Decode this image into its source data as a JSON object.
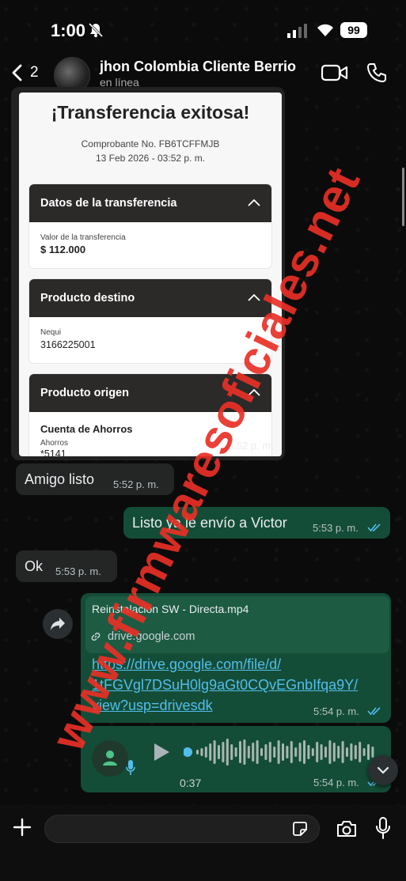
{
  "status_bar": {
    "time": "1:00",
    "battery": "99"
  },
  "header": {
    "unread_count": "2",
    "contact_name": "jhon Colombia Cliente Berrio",
    "contact_status": "en línea"
  },
  "receipt": {
    "title": "¡Transferencia exitosa!",
    "voucher": "Comprobante No. FB6TCFFMJB",
    "date": "13 Feb 2026 - 03:52 p. m.",
    "sections": [
      {
        "title": "Datos de la transferencia",
        "label": "Valor de la transferencia",
        "value": "$ 112.000"
      },
      {
        "title": "Producto destino",
        "label": "Nequi",
        "value": "3166225001"
      },
      {
        "title": "Producto origen",
        "value_bold": "Cuenta de Ahorros",
        "label": "Ahorros",
        "value": "*5141"
      }
    ],
    "time": "5:52 p. m."
  },
  "messages": [
    {
      "direction": "in",
      "text": "Amigo listo",
      "time": "5:52 p. m."
    },
    {
      "direction": "out",
      "text": "Listo ya le envío a Victor",
      "time": "5:53 p. m."
    },
    {
      "direction": "in",
      "text": "Ok",
      "time": "5:53 p. m."
    }
  ],
  "link_message": {
    "preview_title": "Reinstalacion SW - Directa.mp4",
    "preview_domain": "drive.google.com",
    "url_lines": [
      "https://drive.google.com/file/d/",
      "1tFGVgl7DSuH0lg9aGt0CQvEGnbIfqa9Y/",
      "view?usp=drivesdk"
    ],
    "time": "5:54 p. m."
  },
  "audio_message": {
    "duration": "0:37",
    "time": "5:54 p. m."
  },
  "watermark": "www.firmwaresoficiales.net",
  "colors": {
    "outgoing_bubble": "#144d37",
    "incoming_bubble": "#242626",
    "link": "#53bdeb",
    "read_ticks": "#53bdeb",
    "watermark": "#e83026"
  }
}
